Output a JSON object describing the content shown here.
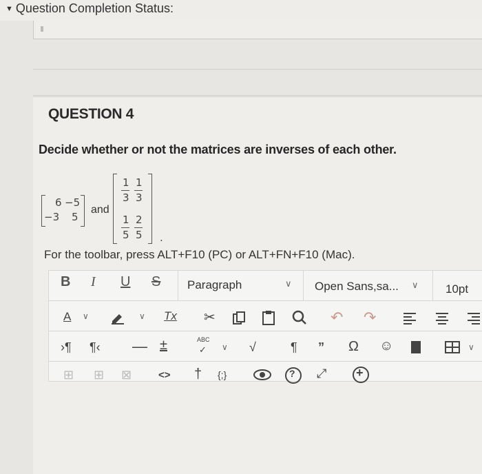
{
  "status": {
    "title": "Question Completion Status:",
    "chevron": "chevron-down-icon"
  },
  "question": {
    "title": "QUESTION 4",
    "text": "Decide whether or not the matrices are inverses of each other.",
    "matrix_a": {
      "r1c1": "6",
      "r1c2": "−5",
      "r2c1": "−3",
      "r2c2": "5"
    },
    "connector": "and",
    "matrix_b": {
      "r1c1": {
        "num": "1",
        "den": "3"
      },
      "r1c2": {
        "num": "1",
        "den": "3"
      },
      "r2c1": {
        "num": "1",
        "den": "5"
      },
      "r2c2": {
        "num": "2",
        "den": "5"
      }
    },
    "trailing": ".",
    "toolbar_hint": "For the toolbar, press ALT+F10 (PC) or ALT+FN+F10 (Mac)."
  },
  "toolbar": {
    "bold": "B",
    "italic": "I",
    "underline": "U",
    "strike": "S",
    "paragraph": "Paragraph",
    "font": "Open Sans,sa...",
    "size": "10pt",
    "text_color": "A",
    "clear_format": "Tx",
    "abc": "ABC",
    "code_view": "<>",
    "braces": "{;}",
    "help": "?"
  }
}
